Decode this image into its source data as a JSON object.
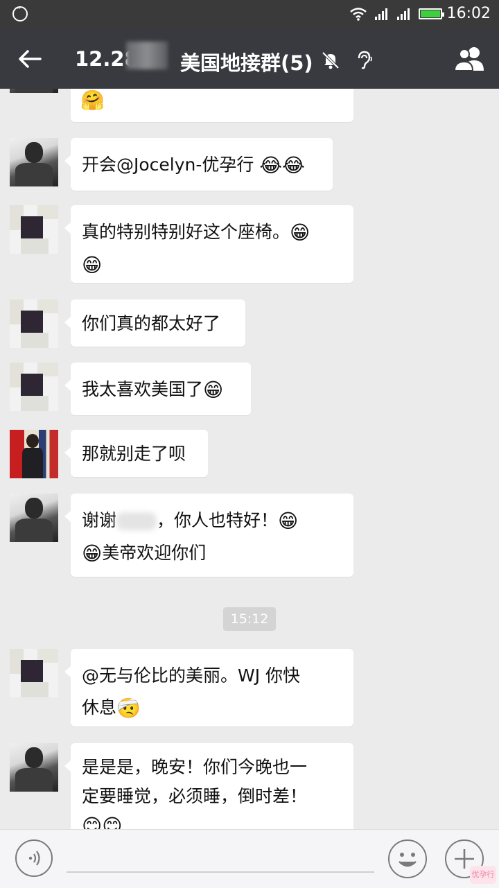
{
  "status_bar": {
    "time": "16:02"
  },
  "header": {
    "date_prefix": "12.28",
    "group_name": "美国地接群(5)"
  },
  "messages": [
    {
      "id": 0,
      "text": "",
      "emoji": "🤗"
    },
    {
      "id": 1,
      "text": "开会@Jocelyn-优孕行 ",
      "emoji": "😂😂"
    },
    {
      "id": 2,
      "text": "真的特别特别好这个座椅。",
      "emoji": "😁",
      "emoji2": "😁"
    },
    {
      "id": 3,
      "text": "你们真的都太好了",
      "emoji": ""
    },
    {
      "id": 4,
      "text": "我太喜欢美国了",
      "emoji": "😁"
    },
    {
      "id": 5,
      "text": "那就别走了呗",
      "emoji": ""
    },
    {
      "id": 6,
      "text_a": "谢谢",
      "text_b": "，你人也特好！",
      "emoji": "😁",
      "emoji2": "😁",
      "text_c": "美帝欢迎你们"
    },
    {
      "id": 7,
      "text_a": "@无与伦比的美丽。WJ 你快",
      "text_b": "休息",
      "emoji": "🤕"
    },
    {
      "id": 8,
      "text_a": "是是是，晚安！你们今晚也一",
      "text_b": "定要睡觉，必须睡，倒时差！",
      "emoji": "😊😊"
    }
  ],
  "timestamp": "15:12",
  "input_bar": {
    "watermark": "优孕行"
  },
  "colors": {
    "title_bg": "#393a3f",
    "chat_bg": "#ebebeb",
    "bubble": "#ffffff",
    "battery": "#3fce3f"
  }
}
